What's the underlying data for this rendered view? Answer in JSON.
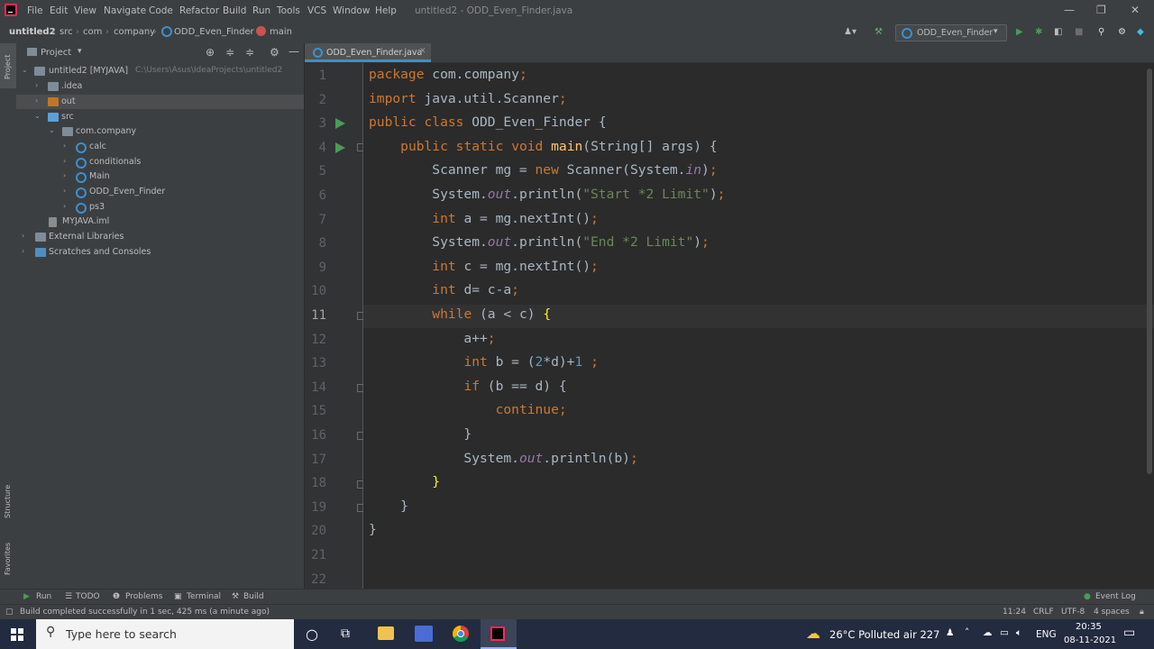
{
  "titlebar": {
    "menus": [
      "File",
      "Edit",
      "View",
      "Navigate",
      "Code",
      "Refactor",
      "Build",
      "Run",
      "Tools",
      "VCS",
      "Window",
      "Help"
    ],
    "title": "untitled2 - ODD_Even_Finder.java"
  },
  "navbar": {
    "breadcrumbs": [
      "untitled2",
      "src",
      "com",
      "company",
      "ODD_Even_Finder",
      "main"
    ],
    "run_config": "ODD_Even_Finder"
  },
  "left_strip": {
    "project": "Project",
    "structure": "Structure",
    "favorites": "Favorites"
  },
  "project_panel": {
    "header": "Project",
    "tree": [
      {
        "label": "untitled2 [MYJAVA]",
        "path": "C:\\Users\\Asus\\IdeaProjects\\untitled2"
      },
      {
        "label": ".idea"
      },
      {
        "label": "out"
      },
      {
        "label": "src"
      },
      {
        "label": "com.company"
      },
      {
        "label": "calc"
      },
      {
        "label": "conditionals"
      },
      {
        "label": "Main"
      },
      {
        "label": "ODD_Even_Finder"
      },
      {
        "label": "ps3"
      },
      {
        "label": "MYJAVA.iml"
      },
      {
        "label": "External Libraries"
      },
      {
        "label": "Scratches and Consoles"
      }
    ]
  },
  "editor": {
    "tab": "ODD_Even_Finder.java",
    "current_line": 11,
    "line_numbers": [
      "1",
      "2",
      "3",
      "4",
      "5",
      "6",
      "7",
      "8",
      "9",
      "10",
      "11",
      "12",
      "13",
      "14",
      "15",
      "16",
      "17",
      "18",
      "19",
      "20",
      "21",
      "22"
    ],
    "code_lines": [
      "package com.company;",
      "import java.util.Scanner;",
      "public class ODD_Even_Finder {",
      "    public static void main(String[] args) {",
      "        Scanner mg = new Scanner(System.in);",
      "        System.out.println(\"Start *2 Limit\");",
      "        int a = mg.nextInt();",
      "        System.out.println(\"End *2 Limit\");",
      "        int c = mg.nextInt();",
      "        int d= c-a;",
      "        while (a < c) {",
      "            a++;",
      "            int b = (2*d)+1 ;",
      "            if (b == d) {",
      "                continue;",
      "            }",
      "            System.out.println(b);",
      "        }",
      "    }",
      "}",
      "",
      ""
    ]
  },
  "tool_windows": {
    "run": "Run",
    "todo": "TODO",
    "problems": "Problems",
    "terminal": "Terminal",
    "build": "Build",
    "event_log": "Event Log"
  },
  "statusbar": {
    "message": "Build completed successfully in 1 sec, 425 ms (a minute ago)",
    "position": "11:24",
    "line_sep": "CRLF",
    "encoding": "UTF-8",
    "indent": "4 spaces"
  },
  "taskbar": {
    "search_placeholder": "Type here to search",
    "weather": "26°C  Polluted air 227",
    "lang": "ENG",
    "time": "20:35",
    "date": "08-11-2021"
  }
}
